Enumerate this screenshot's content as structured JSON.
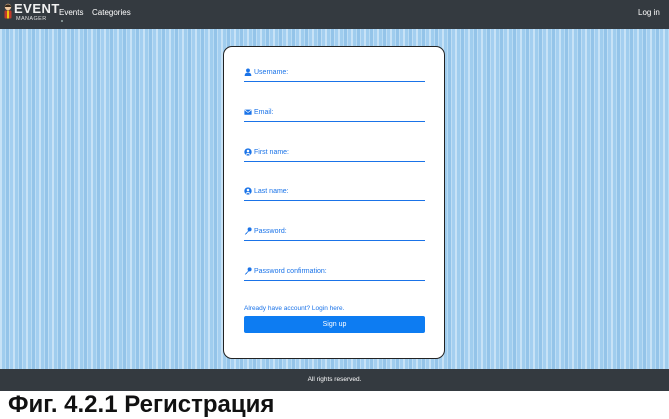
{
  "navbar": {
    "logo_line1": "EVENT",
    "logo_line2": "MANAGER",
    "links": {
      "events": "Events",
      "categories": "Categories"
    },
    "login": "Log in",
    "background_color": "#343a40"
  },
  "form": {
    "fields": [
      {
        "label": "Username:",
        "icon": "user-icon"
      },
      {
        "label": "Email:",
        "icon": "envelope-icon"
      },
      {
        "label": "First name:",
        "icon": "user-circle-icon"
      },
      {
        "label": "Last name:",
        "icon": "user-circle-icon"
      },
      {
        "label": "Password:",
        "icon": "key-icon"
      },
      {
        "label": "Password confirmation:",
        "icon": "key-icon"
      }
    ],
    "login_link": "Already have account? Login here.",
    "submit_label": "Sign up",
    "accent_color": "#1a73e8",
    "button_color": "#0d7cf2"
  },
  "footer": {
    "text": "All rights reserved."
  },
  "caption": "Фиг. 4.2.1 Регистрация"
}
